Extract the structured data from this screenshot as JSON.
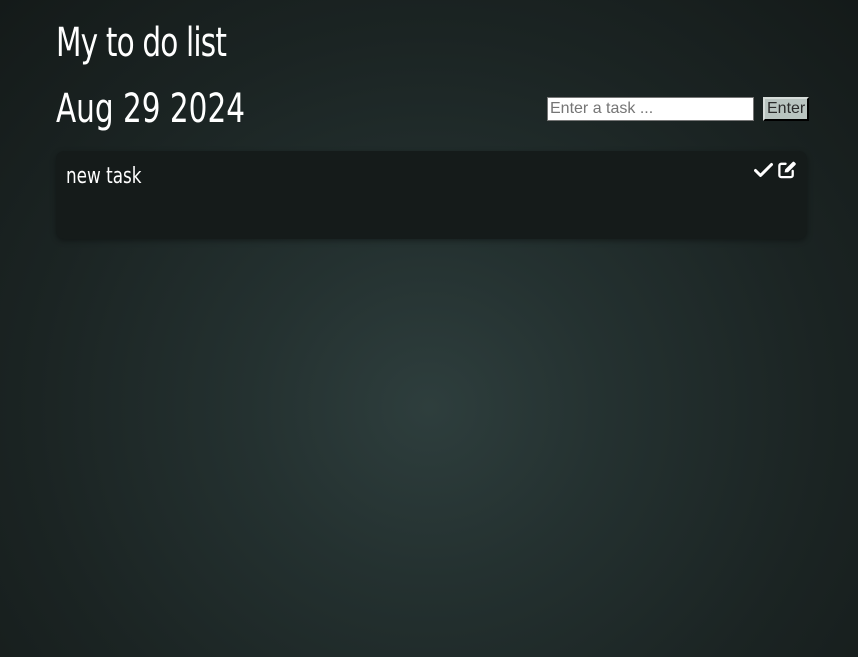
{
  "header": {
    "title": "My to do list",
    "date": "Aug 29 2024"
  },
  "form": {
    "input_value": "",
    "input_placeholder": "Enter a task ...",
    "submit_label": "Enter"
  },
  "tasks": [
    {
      "text": "new task",
      "icons": [
        "check-icon",
        "edit-icon"
      ]
    }
  ],
  "colors": {
    "background_center": "#2e3e3d",
    "background_edge": "#141a19",
    "card": "#151b1a",
    "text": "#ffffff",
    "button": "#b9c4c0"
  }
}
